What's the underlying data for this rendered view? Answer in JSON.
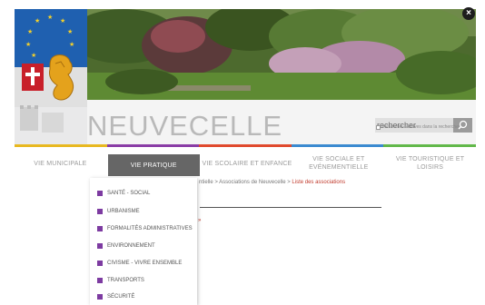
{
  "site": {
    "name": "NEUVECELLE"
  },
  "search": {
    "placeholder": "rechercher",
    "archive_label": "Inclure les archives dans la recherche"
  },
  "colors": {
    "accent_bar": [
      "#e8b820",
      "#8a3da6",
      "#e04a2e",
      "#3b8ad0",
      "#62b84a"
    ],
    "nav_active_bg": "#666666",
    "menu_square": "#7d3ba1",
    "breadcrumb_current": "#c0392b"
  },
  "nav": {
    "items": [
      {
        "label": "Vie Municipale"
      },
      {
        "label": "Vie Pratique"
      },
      {
        "label": "Vie scolaire et enfance"
      },
      {
        "label": "Vie sociale et Evénementielle"
      },
      {
        "label": "Vie touristique et Loisirs"
      }
    ]
  },
  "dropdown": {
    "items": [
      {
        "label": "Santé - Social"
      },
      {
        "label": "Urbanisme"
      },
      {
        "label": "Formalités administratives"
      },
      {
        "label": "Environnement"
      },
      {
        "label": "Civisme - Vivre ensemble"
      },
      {
        "label": "Transports"
      },
      {
        "label": "Sécurité"
      }
    ]
  },
  "breadcrumb": {
    "prefix": "ntielle > Associations de Neuvecelle > ",
    "current": "Liste des associations"
  },
  "icons": {
    "close": "close-icon",
    "search": "search-icon",
    "crest": "town-crest-logo"
  }
}
